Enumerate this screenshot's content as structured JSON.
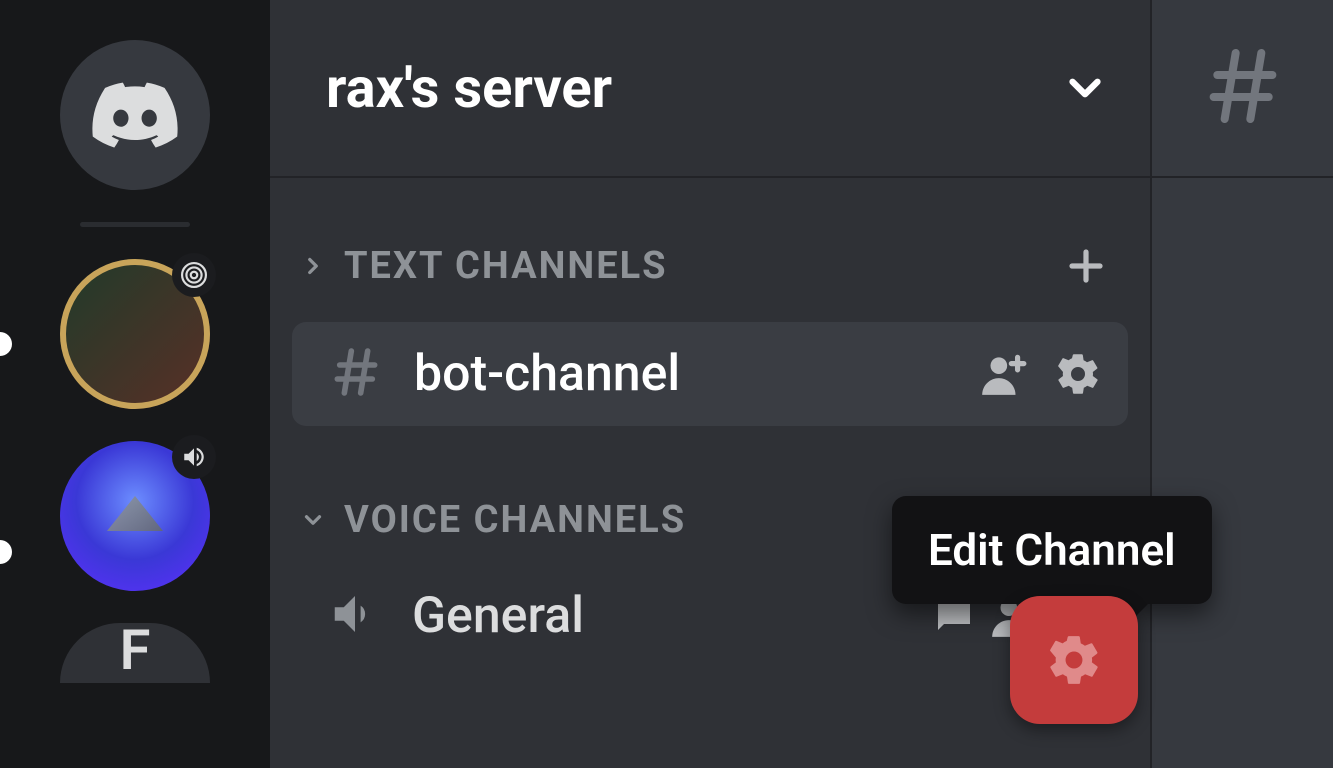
{
  "server": {
    "name": "rax's server"
  },
  "categories": {
    "text": {
      "label": "TEXT CHANNELS",
      "channels": [
        {
          "name": "bot-channel"
        }
      ]
    },
    "voice": {
      "label": "VOICE CHANNELS",
      "channels": [
        {
          "name": "General"
        }
      ]
    }
  },
  "tooltip": {
    "edit_channel": "Edit Channel"
  },
  "rail": {
    "partial_server_letter": "F"
  }
}
